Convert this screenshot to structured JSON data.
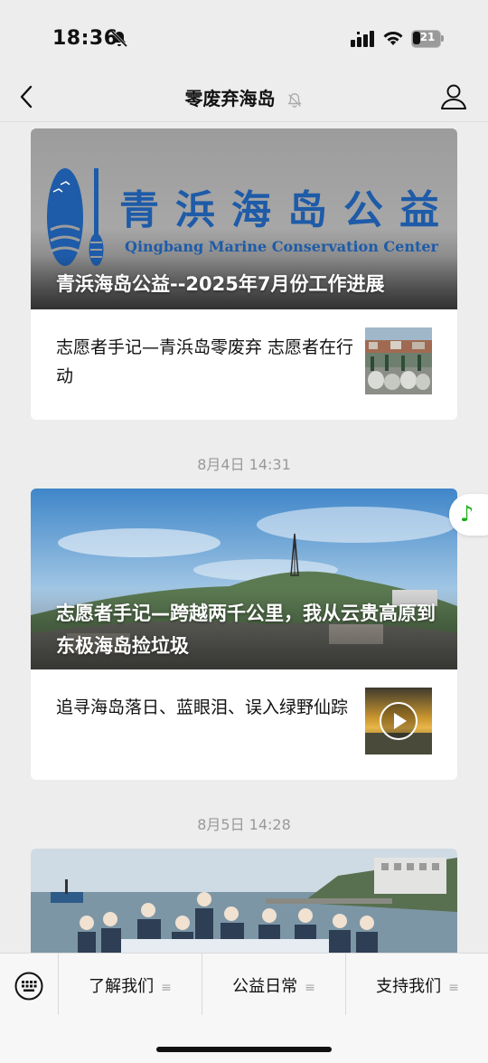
{
  "status_bar": {
    "time": "18:36",
    "battery_level": "21"
  },
  "nav": {
    "title": "零废弃海岛"
  },
  "article1": {
    "hero_caption": "青浜海岛公益--2025年7月份工作进展",
    "logo_text_cn": "青浜海岛公益",
    "logo_text_en": "Qingbang Marine Conservation Center",
    "sub_title": "志愿者手记—青浜岛零废弃 志愿者在行动"
  },
  "date1": "8月4日 14:31",
  "article2": {
    "hero_caption": "志愿者手记—跨越两千公里，我从云贵高原到东极海岛捡垃圾",
    "sub_title": "追寻海岛落日、蓝眼泪、误入绿野仙踪"
  },
  "date2": "8月5日 14:28",
  "bottom_menu": {
    "items": [
      {
        "label": "了解我们"
      },
      {
        "label": "公益日常"
      },
      {
        "label": "支持我们"
      }
    ]
  },
  "colors": {
    "accent_green": "#1aad19",
    "logo_blue": "#1e5ba8"
  }
}
